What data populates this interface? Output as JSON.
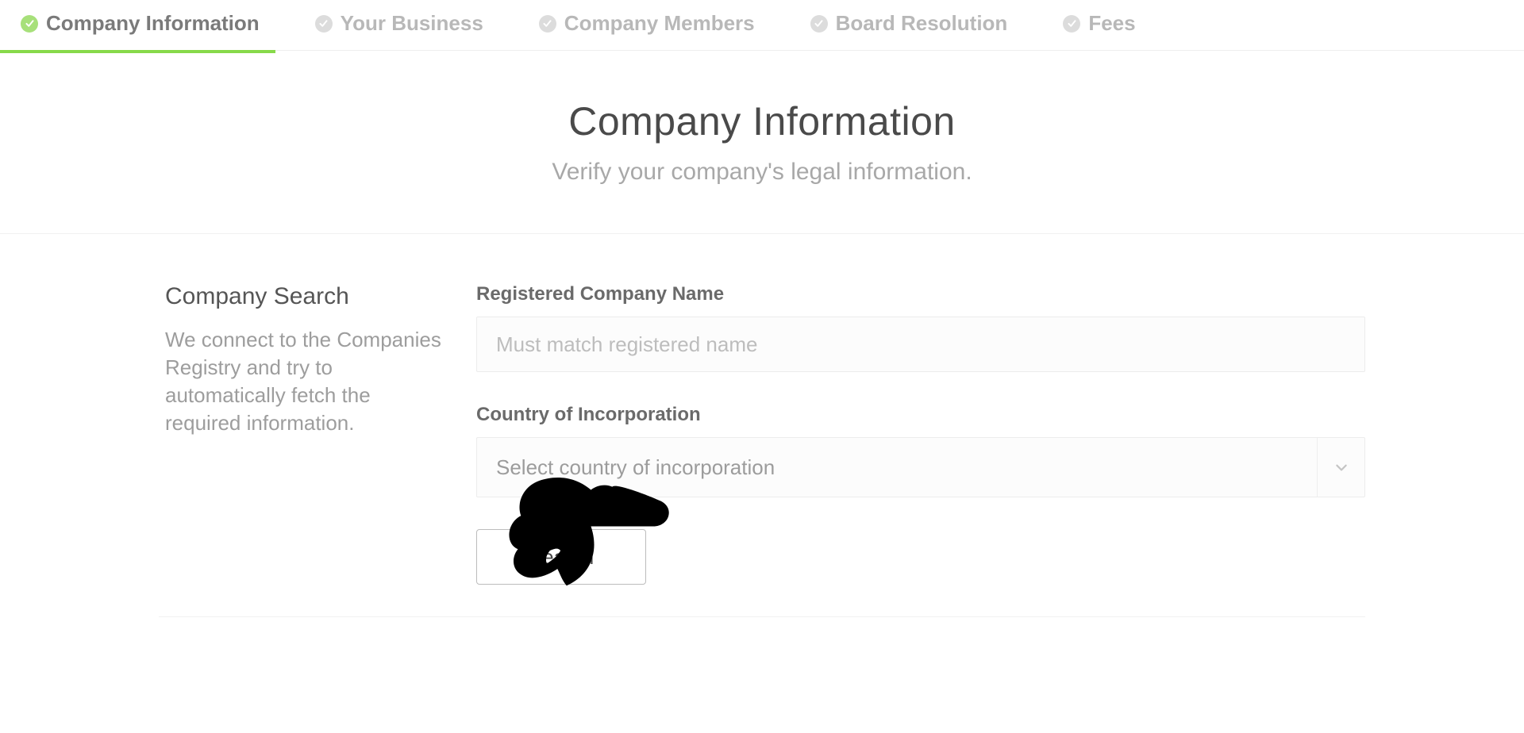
{
  "stepper": {
    "items": [
      {
        "label": "Company Information",
        "active": true
      },
      {
        "label": "Your Business",
        "active": false
      },
      {
        "label": "Company Members",
        "active": false
      },
      {
        "label": "Board Resolution",
        "active": false
      },
      {
        "label": "Fees",
        "active": false
      }
    ]
  },
  "header": {
    "title": "Company Information",
    "subtitle": "Verify your company's legal information."
  },
  "sidebar": {
    "title": "Company Search",
    "text": "We connect to the Companies Registry and try to automatically fetch the required information."
  },
  "form": {
    "company_name": {
      "label": "Registered Company Name",
      "placeholder": "Must match registered name",
      "value": ""
    },
    "country": {
      "label": "Country of Incorporation",
      "placeholder": "Select country of incorporation",
      "value": ""
    },
    "search_label": "Search"
  }
}
